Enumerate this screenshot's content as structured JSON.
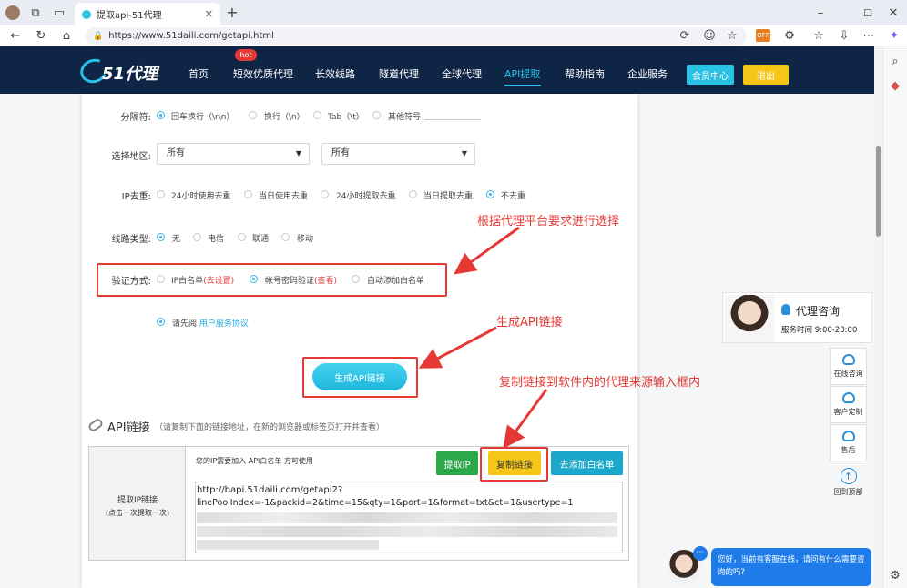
{
  "browser": {
    "tab_title": "提取api-51代理",
    "url": "https://www.51daili.com/getapi.html"
  },
  "nav": {
    "logo_text": "51代理",
    "items": [
      "首页",
      "短效优质代理",
      "长效线路",
      "隧道代理",
      "全球代理",
      "API提取",
      "帮助指南",
      "企业服务"
    ],
    "hot_badge": "hot",
    "member_label": "会员中心",
    "logout_label": "退出"
  },
  "form": {
    "separator": {
      "label": "分隔符:",
      "options": [
        "回车换行（\\r\\n）",
        "换行（\\n）",
        "Tab（\\t）",
        "其他符号"
      ]
    },
    "region": {
      "label": "选择地区:",
      "select1": "所有",
      "select2": "所有"
    },
    "dedup": {
      "label": "IP去重:",
      "options": [
        "24小时使用去重",
        "当日使用去重",
        "24小时提取去重",
        "当日提取去重",
        "不去重"
      ]
    },
    "line_type": {
      "label": "线路类型:",
      "options": [
        "无",
        "电信",
        "联通",
        "移动"
      ]
    },
    "auth": {
      "label": "验证方式:",
      "opt1": "IP白名单",
      "opt1_link": "(去设置)",
      "opt2": "帐号密码验证",
      "opt2_link": "(查看)",
      "opt3": "自动添加白名单"
    },
    "agreement": {
      "text": "请先阅",
      "link": "用户服务协议"
    },
    "generate_label": "生成API链接"
  },
  "annotations": {
    "select_hint": "根据代理平台要求进行选择",
    "generate_hint": "生成API链接",
    "copy_hint": "复制链接到软件内的代理来源输入框内"
  },
  "api_section": {
    "title": "API链接",
    "subtitle": "（请复制下面的链接地址，在新的浏览器或标签页打开并查看）",
    "left_label": "提取IP链接",
    "left_note": "(点击一次提取一次)",
    "notice": "您的IP需要加入 API白名单 方可使用",
    "btn_fetch": "提取IP",
    "btn_copy": "复制链接",
    "btn_whitelist": "去添加白名单",
    "link_line1": "http://bapi.51daili.com/getapi2?",
    "link_line2": "linePoolIndex=-1&packid=2&time=15&qty=1&port=1&format=txt&ct=1&usertype=1"
  },
  "consult": {
    "title": "代理咨询",
    "hours": "服务时间 9:00-23:00"
  },
  "side_buttons": [
    "在线咨询",
    "客户定制",
    "售后",
    "回到顶部"
  ],
  "chat": {
    "message": "您好，当前有客服在线，请问有什么需要咨询的吗?"
  },
  "colors": {
    "nav_bg": "#0e2546",
    "accent": "#29c1e6",
    "annotation_red": "#e53935",
    "copy_btn": "#f5c518",
    "fetch_btn": "#2aa84a",
    "whitelist_btn": "#1aa7c9"
  }
}
